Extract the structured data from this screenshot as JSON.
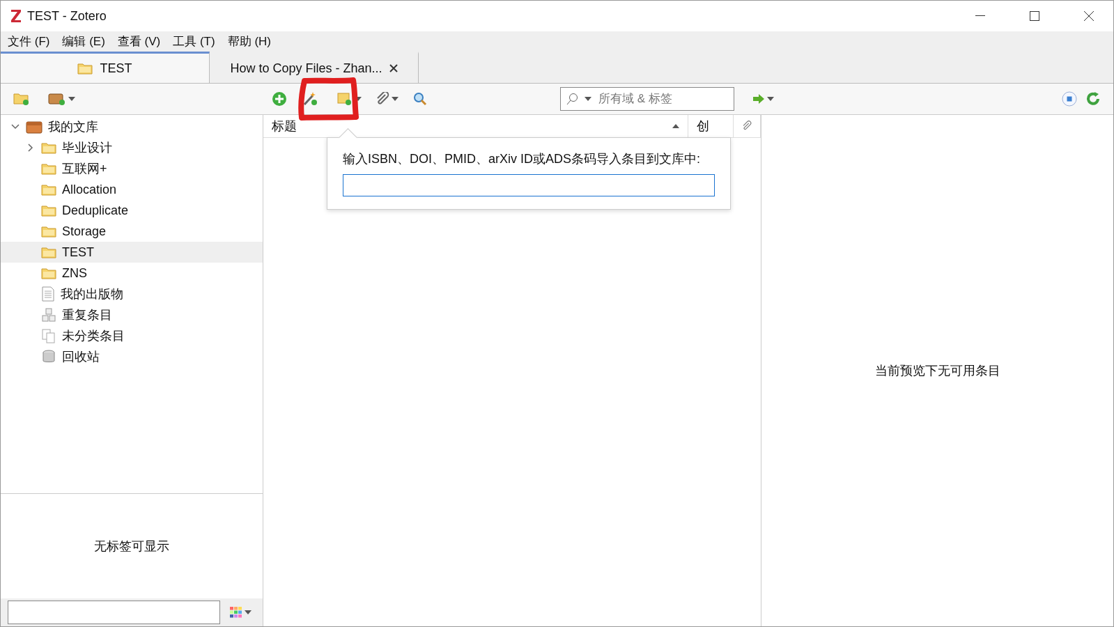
{
  "window": {
    "title": "TEST - Zotero"
  },
  "menu": [
    "文件 (F)",
    "编辑 (E)",
    "查看 (V)",
    "工具 (T)",
    "帮助 (H)"
  ],
  "tabs": [
    {
      "label": "TEST",
      "kind": "library",
      "selected": true,
      "closable": false
    },
    {
      "label": "How to Copy Files - Zhan...",
      "kind": "reader",
      "selected": false,
      "closable": true
    }
  ],
  "toolbar": {
    "search": {
      "placeholder": "所有域 & 标签"
    }
  },
  "collections": [
    {
      "label": "我的文库",
      "kind": "library",
      "expanded": true,
      "selected": false,
      "children": [
        {
          "label": "毕业设计",
          "kind": "folder",
          "selected": false,
          "expanded": false,
          "has_children": true
        },
        {
          "label": "互联网+",
          "kind": "folder",
          "selected": false
        },
        {
          "label": "Allocation",
          "kind": "folder",
          "selected": false
        },
        {
          "label": "Deduplicate",
          "kind": "folder",
          "selected": false
        },
        {
          "label": "Storage",
          "kind": "folder",
          "selected": false
        },
        {
          "label": "TEST",
          "kind": "folder",
          "selected": true
        },
        {
          "label": "ZNS",
          "kind": "folder",
          "selected": false
        },
        {
          "label": "我的出版物",
          "kind": "publications",
          "selected": false
        },
        {
          "label": "重复条目",
          "kind": "duplicates",
          "selected": false
        },
        {
          "label": "未分类条目",
          "kind": "unfiled",
          "selected": false
        },
        {
          "label": "回收站",
          "kind": "trash",
          "selected": false
        }
      ]
    }
  ],
  "tag_pane": {
    "message": "无标签可显示"
  },
  "items_table": {
    "columns": [
      {
        "label": "标题",
        "sorted": true
      },
      {
        "label": "创",
        "sorted": false
      }
    ]
  },
  "popup": {
    "label": "输入ISBN、DOI、PMID、arXiv ID或ADS条码导入条目到文库中:"
  },
  "item_pane": {
    "message": "当前预览下无可用条目"
  }
}
